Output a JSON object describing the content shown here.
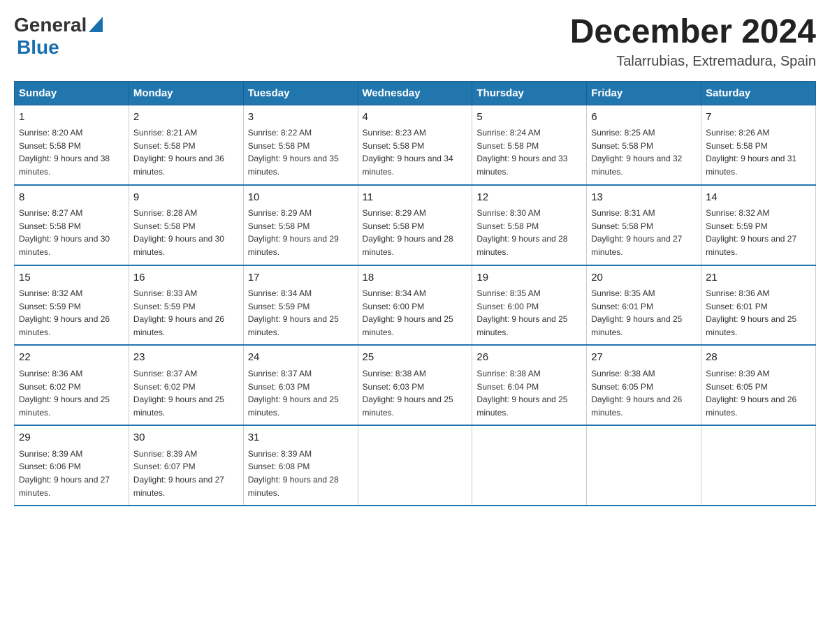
{
  "header": {
    "logo_general": "General",
    "logo_blue": "Blue",
    "month_title": "December 2024",
    "location": "Talarrubias, Extremadura, Spain"
  },
  "weekdays": [
    "Sunday",
    "Monday",
    "Tuesday",
    "Wednesday",
    "Thursday",
    "Friday",
    "Saturday"
  ],
  "weeks": [
    [
      {
        "day": "1",
        "sunrise": "8:20 AM",
        "sunset": "5:58 PM",
        "daylight": "9 hours and 38 minutes."
      },
      {
        "day": "2",
        "sunrise": "8:21 AM",
        "sunset": "5:58 PM",
        "daylight": "9 hours and 36 minutes."
      },
      {
        "day": "3",
        "sunrise": "8:22 AM",
        "sunset": "5:58 PM",
        "daylight": "9 hours and 35 minutes."
      },
      {
        "day": "4",
        "sunrise": "8:23 AM",
        "sunset": "5:58 PM",
        "daylight": "9 hours and 34 minutes."
      },
      {
        "day": "5",
        "sunrise": "8:24 AM",
        "sunset": "5:58 PM",
        "daylight": "9 hours and 33 minutes."
      },
      {
        "day": "6",
        "sunrise": "8:25 AM",
        "sunset": "5:58 PM",
        "daylight": "9 hours and 32 minutes."
      },
      {
        "day": "7",
        "sunrise": "8:26 AM",
        "sunset": "5:58 PM",
        "daylight": "9 hours and 31 minutes."
      }
    ],
    [
      {
        "day": "8",
        "sunrise": "8:27 AM",
        "sunset": "5:58 PM",
        "daylight": "9 hours and 30 minutes."
      },
      {
        "day": "9",
        "sunrise": "8:28 AM",
        "sunset": "5:58 PM",
        "daylight": "9 hours and 30 minutes."
      },
      {
        "day": "10",
        "sunrise": "8:29 AM",
        "sunset": "5:58 PM",
        "daylight": "9 hours and 29 minutes."
      },
      {
        "day": "11",
        "sunrise": "8:29 AM",
        "sunset": "5:58 PM",
        "daylight": "9 hours and 28 minutes."
      },
      {
        "day": "12",
        "sunrise": "8:30 AM",
        "sunset": "5:58 PM",
        "daylight": "9 hours and 28 minutes."
      },
      {
        "day": "13",
        "sunrise": "8:31 AM",
        "sunset": "5:58 PM",
        "daylight": "9 hours and 27 minutes."
      },
      {
        "day": "14",
        "sunrise": "8:32 AM",
        "sunset": "5:59 PM",
        "daylight": "9 hours and 27 minutes."
      }
    ],
    [
      {
        "day": "15",
        "sunrise": "8:32 AM",
        "sunset": "5:59 PM",
        "daylight": "9 hours and 26 minutes."
      },
      {
        "day": "16",
        "sunrise": "8:33 AM",
        "sunset": "5:59 PM",
        "daylight": "9 hours and 26 minutes."
      },
      {
        "day": "17",
        "sunrise": "8:34 AM",
        "sunset": "5:59 PM",
        "daylight": "9 hours and 25 minutes."
      },
      {
        "day": "18",
        "sunrise": "8:34 AM",
        "sunset": "6:00 PM",
        "daylight": "9 hours and 25 minutes."
      },
      {
        "day": "19",
        "sunrise": "8:35 AM",
        "sunset": "6:00 PM",
        "daylight": "9 hours and 25 minutes."
      },
      {
        "day": "20",
        "sunrise": "8:35 AM",
        "sunset": "6:01 PM",
        "daylight": "9 hours and 25 minutes."
      },
      {
        "day": "21",
        "sunrise": "8:36 AM",
        "sunset": "6:01 PM",
        "daylight": "9 hours and 25 minutes."
      }
    ],
    [
      {
        "day": "22",
        "sunrise": "8:36 AM",
        "sunset": "6:02 PM",
        "daylight": "9 hours and 25 minutes."
      },
      {
        "day": "23",
        "sunrise": "8:37 AM",
        "sunset": "6:02 PM",
        "daylight": "9 hours and 25 minutes."
      },
      {
        "day": "24",
        "sunrise": "8:37 AM",
        "sunset": "6:03 PM",
        "daylight": "9 hours and 25 minutes."
      },
      {
        "day": "25",
        "sunrise": "8:38 AM",
        "sunset": "6:03 PM",
        "daylight": "9 hours and 25 minutes."
      },
      {
        "day": "26",
        "sunrise": "8:38 AM",
        "sunset": "6:04 PM",
        "daylight": "9 hours and 25 minutes."
      },
      {
        "day": "27",
        "sunrise": "8:38 AM",
        "sunset": "6:05 PM",
        "daylight": "9 hours and 26 minutes."
      },
      {
        "day": "28",
        "sunrise": "8:39 AM",
        "sunset": "6:05 PM",
        "daylight": "9 hours and 26 minutes."
      }
    ],
    [
      {
        "day": "29",
        "sunrise": "8:39 AM",
        "sunset": "6:06 PM",
        "daylight": "9 hours and 27 minutes."
      },
      {
        "day": "30",
        "sunrise": "8:39 AM",
        "sunset": "6:07 PM",
        "daylight": "9 hours and 27 minutes."
      },
      {
        "day": "31",
        "sunrise": "8:39 AM",
        "sunset": "6:08 PM",
        "daylight": "9 hours and 28 minutes."
      },
      null,
      null,
      null,
      null
    ]
  ]
}
